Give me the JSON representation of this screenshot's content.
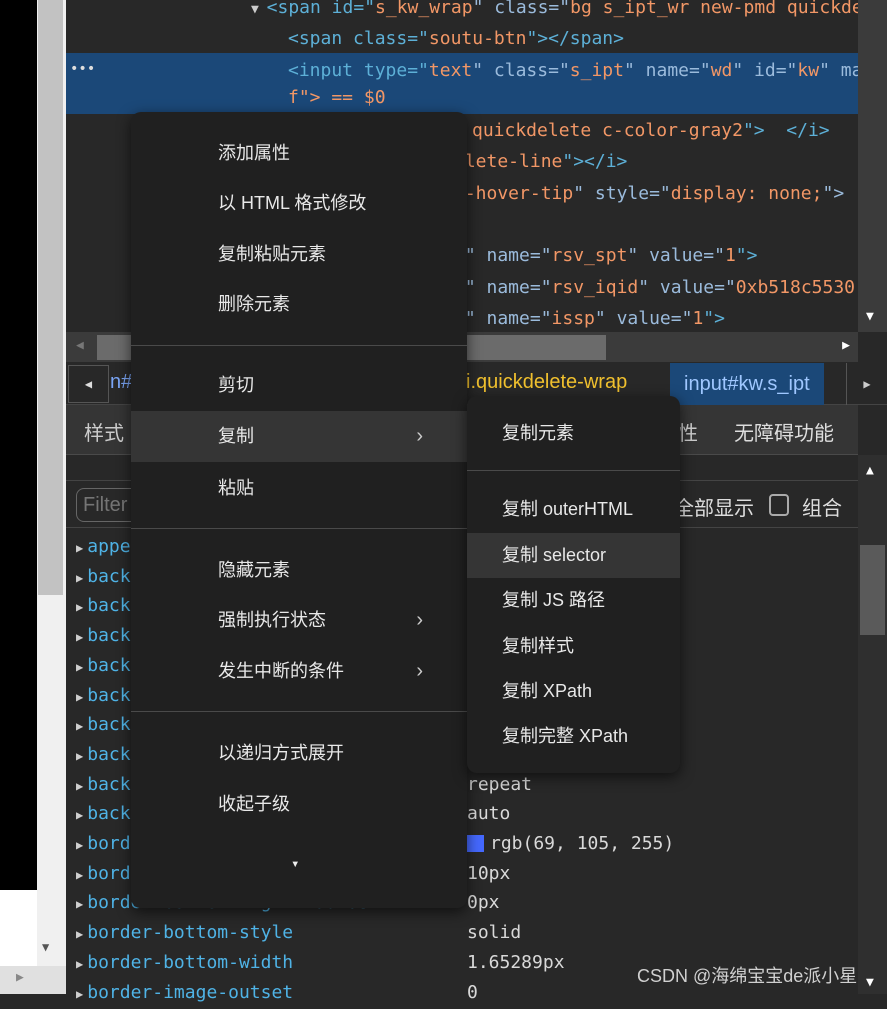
{
  "elements_tree": {
    "line1": {
      "tag": "<span id=\"",
      "v1": "s_kw_wrap",
      "a1": "\" class=\"",
      "v2": "bg s_ipt_wr new-pmd quickde"
    },
    "line2": {
      "tag": "<span class=\"",
      "v": "soutu-btn",
      "end": "\"></span>"
    },
    "selected_line": {
      "tag": "<input type=\"",
      "v1": "text",
      "a1": "\" class=\"",
      "v2": "s_ipt",
      "a2": "\" name=\"",
      "v3": "wd",
      "a3": "\" id=\"",
      "v4": "kw",
      "a4": "\" ma",
      "cont": "f\"> == $0"
    },
    "dots": "•••",
    "line4": {
      "v": "quickdelete c-color-gray2",
      "end": "\">  </i>"
    },
    "line5": {
      "v": "elete-line",
      "end": "\"></i>"
    },
    "line6": {
      "v": "u-hover-tip",
      "a": "\" style=\"",
      "v2": "display: none;",
      "end": "\">"
    },
    "line7": {
      "pre": "n\" name=\"",
      "v": "rsv_spt",
      "a": "\" value=\"",
      "v2": "1",
      "end": "\">"
    },
    "line8": {
      "pre": "n\" name=\"",
      "v": "rsv_iqid",
      "a": "\" value=\"",
      "v2": "0xb518c5530"
    },
    "line9": {
      "pre": "n\" name=\"",
      "v": "issp",
      "a": "\" value=\"",
      "v2": "1",
      "end": "\">"
    }
  },
  "breadcrumbs": {
    "left_partial": "n#",
    "middle": "i.quickdelete-wrap",
    "active": "input#kw.s_ipt"
  },
  "tabs": {
    "styles": "样式",
    "partial": "性",
    "accessibility": "无障碍功能"
  },
  "filter": {
    "placeholder": "Filter",
    "show_all": "全部显示",
    "group": "组合"
  },
  "properties": [
    {
      "name": "appe",
      "value": ""
    },
    {
      "name": "back",
      "value": ""
    },
    {
      "name": "back",
      "value": ""
    },
    {
      "name": "back",
      "value": ""
    },
    {
      "name": "back",
      "value": ""
    },
    {
      "name": "back",
      "value": ""
    },
    {
      "name": "back",
      "value": ""
    },
    {
      "name": "back",
      "value": ""
    },
    {
      "name": "back",
      "value": "repeat"
    },
    {
      "name": "back",
      "value": "auto"
    },
    {
      "name": "bord",
      "value": "rgb(69, 105, 255)",
      "swatch": "#4569ff"
    },
    {
      "name": "bord",
      "value": "10px"
    },
    {
      "name": "border-bottom-right-radius",
      "value": "0px"
    },
    {
      "name": "border-bottom-style",
      "value": "solid"
    },
    {
      "name": "border-bottom-width",
      "value": "1.65289px"
    },
    {
      "name": "border-image-outset",
      "value": "0"
    }
  ],
  "context_menu": {
    "items": [
      "添加属性",
      "以 HTML 格式修改",
      "复制粘贴元素",
      "删除元素",
      "剪切",
      "复制",
      "粘贴",
      "隐藏元素",
      "强制执行状态",
      "发生中断的条件",
      "以递归方式展开",
      "收起子级"
    ],
    "more": "▾"
  },
  "copy_submenu": {
    "items": [
      "复制元素",
      "复制 outerHTML",
      "复制 selector",
      "复制 JS 路径",
      "复制样式",
      "复制 XPath",
      "复制完整 XPath"
    ]
  },
  "watermark": "CSDN @海绵宝宝de派小星",
  "colors": {
    "selected_row": "#1b4878",
    "menu_bg": "#202020",
    "highlight": "#353535",
    "prop_name": "#4fb3e6",
    "attr_value": "#f29766"
  }
}
